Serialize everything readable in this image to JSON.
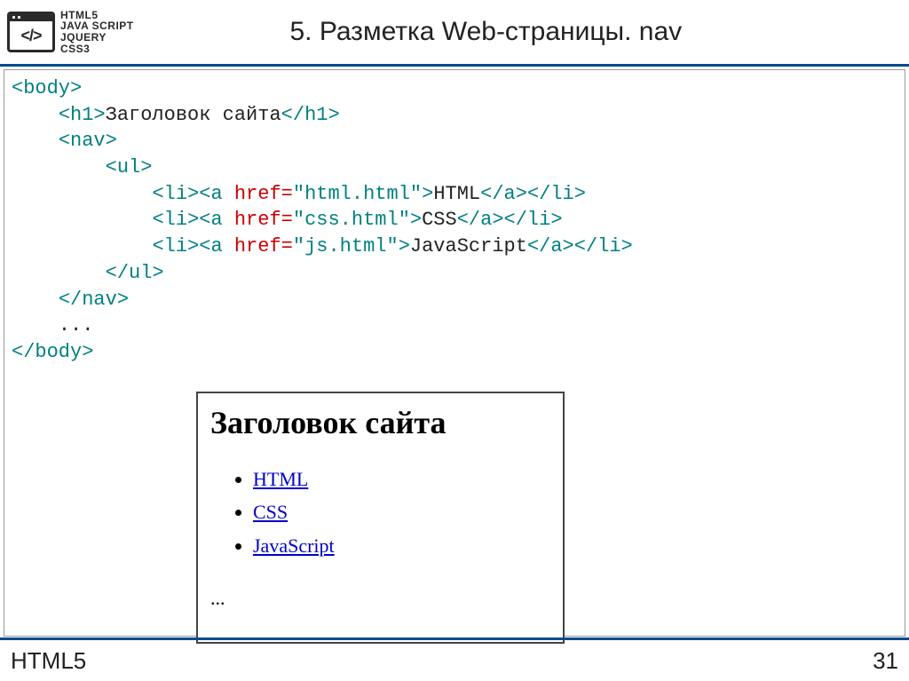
{
  "header": {
    "logo_lines": "HTML5\nJAVA SCRIPT\nJQUERY\nCSS3",
    "code_glyph": "</>",
    "title": "5. Разметка Web-страницы. nav"
  },
  "code": {
    "l1_open": "<body>",
    "l2_open": "<h1>",
    "l2_text": "Заголовок сайта",
    "l2_close": "</h1>",
    "l3_open": "<nav>",
    "l4_open": "<ul>",
    "li_open": "<li>",
    "a_open": "<a",
    "href_attr": " href=",
    "a_tag_close": ">",
    "a_close": "</a>",
    "li_close": "</li>",
    "href1": "\"html.html\"",
    "txt1": "HTML",
    "href2": "\"css.html\"",
    "txt2": "CSS",
    "href3": "\"js.html\"",
    "txt3": "JavaScript",
    "ul_close": "</ul>",
    "nav_close": "</nav>",
    "dots": "...",
    "body_close": "</body>"
  },
  "preview": {
    "heading": "Заголовок сайта",
    "items": {
      "0": "HTML",
      "1": "CSS",
      "2": "JavaScript"
    },
    "dots": "..."
  },
  "footer": {
    "left": "HTML5",
    "page": "31"
  }
}
